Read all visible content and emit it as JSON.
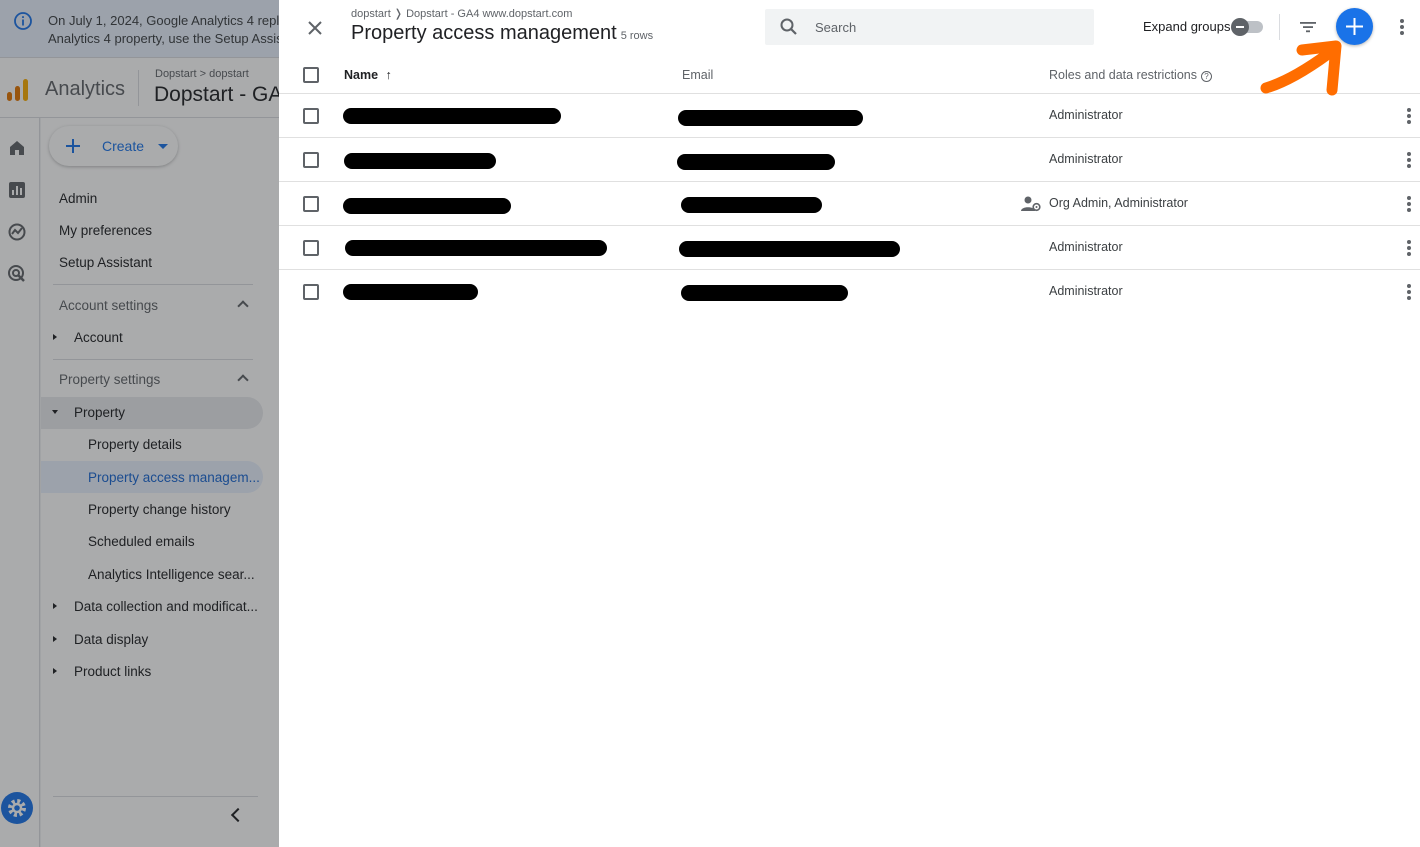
{
  "banner": {
    "text_line1": "On July 1, 2024, Google Analytics 4 repla",
    "text_line2": "Analytics 4 property, use the Setup Assis"
  },
  "appbar": {
    "app_name": "Analytics",
    "crumb": "Dopstart > dopstart",
    "property_title": "Dopstart - GA"
  },
  "sidenav": {
    "create_label": "Create",
    "admin": "Admin",
    "my_preferences": "My preferences",
    "setup_assistant": "Setup Assistant",
    "account_settings": "Account settings",
    "account": "Account",
    "property_settings": "Property settings",
    "property": "Property",
    "property_details": "Property details",
    "property_access": "Property access managem...",
    "property_change_history": "Property change history",
    "scheduled_emails": "Scheduled emails",
    "analytics_intelligence": "Analytics Intelligence sear...",
    "data_collection": "Data collection and modificat...",
    "data_display": "Data display",
    "product_links": "Product links"
  },
  "panel": {
    "breadcrumb": "dopstart ❭ Dopstart - GA4 www.dopstart.com",
    "title": "Property access management",
    "rows_count": "5 rows",
    "search_placeholder": "Search",
    "expand_groups": "Expand groups",
    "columns": {
      "name": "Name",
      "name_sort": "↑",
      "email": "Email",
      "roles": "Roles and data restrictions",
      "roles_help": "?"
    },
    "rows": [
      {
        "role": "Administrator"
      },
      {
        "role": "Administrator"
      },
      {
        "role": "Org Admin, Administrator"
      },
      {
        "role": "Administrator"
      },
      {
        "role": "Administrator"
      }
    ]
  },
  "colors": {
    "accent": "#1a73e8",
    "annotation": "#ff6d00",
    "scrim": "rgba(32,33,36,0.38)"
  },
  "icons": [
    "info-icon",
    "analytics-logo-icon",
    "home-icon",
    "reports-icon",
    "explore-icon",
    "advertising-icon",
    "gear-icon",
    "close-icon",
    "search-icon",
    "filter-icon",
    "add-icon",
    "more-vert-icon",
    "org-admin-icon",
    "chevron-up-icon",
    "collapse-chevron-icon"
  ]
}
